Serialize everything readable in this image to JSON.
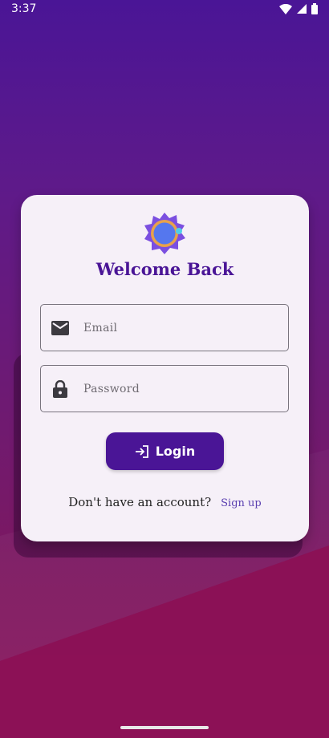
{
  "status_bar": {
    "time": "3:37",
    "icons": [
      "wifi-icon",
      "signal-icon",
      "battery-icon"
    ]
  },
  "login_card": {
    "logo_icon": "sun-badge-logo",
    "title": "Welcome Back",
    "email_field": {
      "placeholder": "Email",
      "value": "",
      "icon": "mail-icon"
    },
    "password_field": {
      "placeholder": "Password",
      "value": "",
      "icon": "lock-icon"
    },
    "login_button": {
      "label": "Login",
      "icon": "login-icon"
    },
    "signup_prompt": "Don't have an account?",
    "signup_link": "Sign up"
  },
  "colors": {
    "primary": "#4a1596",
    "card_background": "#f6f0f8",
    "link": "#5a3fb0",
    "background_top": "#4a1596",
    "background_bottom": "#8a145a"
  }
}
